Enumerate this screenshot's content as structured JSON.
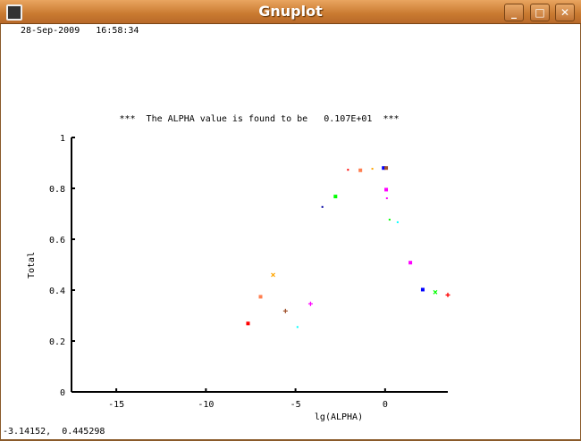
{
  "window": {
    "title": "Gnuplot",
    "buttons": [
      "minimize",
      "maximize",
      "close"
    ]
  },
  "timestamp": "28-Sep-2009   16:58:34",
  "status_readout": "-3.14152,  0.445298",
  "chart_data": {
    "type": "scatter",
    "title": "***  The ALPHA value is found to be   0.107E+01  ***",
    "xlabel": "lg(ALPHA)",
    "ylabel": "Total",
    "xlim": [
      -17.5,
      3.5
    ],
    "ylim": [
      0,
      1
    ],
    "xticks": [
      -15,
      -10,
      -5,
      0
    ],
    "yticks": [
      0,
      0.2,
      0.4,
      0.6,
      0.8,
      1
    ],
    "ytick_labels": [
      "0",
      "0.2",
      "0.4",
      "0.6",
      "0.8",
      "1"
    ],
    "grid": false,
    "points": [
      {
        "x": -7.65,
        "y": 0.269,
        "color": "#ff0000",
        "marker": "square"
      },
      {
        "x": -6.95,
        "y": 0.374,
        "color": "#ff7f50",
        "marker": "square"
      },
      {
        "x": -6.25,
        "y": 0.46,
        "color": "#ffa500",
        "marker": "x"
      },
      {
        "x": -5.56,
        "y": 0.318,
        "color": "#a0522d",
        "marker": "plus"
      },
      {
        "x": -4.89,
        "y": 0.255,
        "color": "#00ffff",
        "marker": "dot"
      },
      {
        "x": -4.16,
        "y": 0.346,
        "color": "#ff00ff",
        "marker": "plus"
      },
      {
        "x": -3.5,
        "y": 0.727,
        "color": "#0000a0",
        "marker": "dot"
      },
      {
        "x": -2.77,
        "y": 0.768,
        "color": "#00ff00",
        "marker": "square"
      },
      {
        "x": -2.07,
        "y": 0.873,
        "color": "#ff0000",
        "marker": "dot"
      },
      {
        "x": -1.38,
        "y": 0.871,
        "color": "#ff7f50",
        "marker": "square"
      },
      {
        "x": -0.71,
        "y": 0.877,
        "color": "#ffa500",
        "marker": "dot"
      },
      {
        "x": -0.08,
        "y": 0.88,
        "color": "#0000ff",
        "marker": "square"
      },
      {
        "x": 0.06,
        "y": 0.88,
        "color": "#a0522d",
        "marker": "square"
      },
      {
        "x": 0.06,
        "y": 0.795,
        "color": "#ff00ff",
        "marker": "square"
      },
      {
        "x": 0.1,
        "y": 0.761,
        "color": "#ff00ff",
        "marker": "dot"
      },
      {
        "x": 0.25,
        "y": 0.677,
        "color": "#00ff00",
        "marker": "dot"
      },
      {
        "x": 0.7,
        "y": 0.667,
        "color": "#00ffff",
        "marker": "dot"
      },
      {
        "x": 1.41,
        "y": 0.508,
        "color": "#ff00ff",
        "marker": "square"
      },
      {
        "x": 2.1,
        "y": 0.402,
        "color": "#0000ff",
        "marker": "square"
      },
      {
        "x": 2.8,
        "y": 0.392,
        "color": "#00ff00",
        "marker": "x"
      },
      {
        "x": 3.5,
        "y": 0.381,
        "color": "#ff0000",
        "marker": "plus"
      }
    ]
  }
}
